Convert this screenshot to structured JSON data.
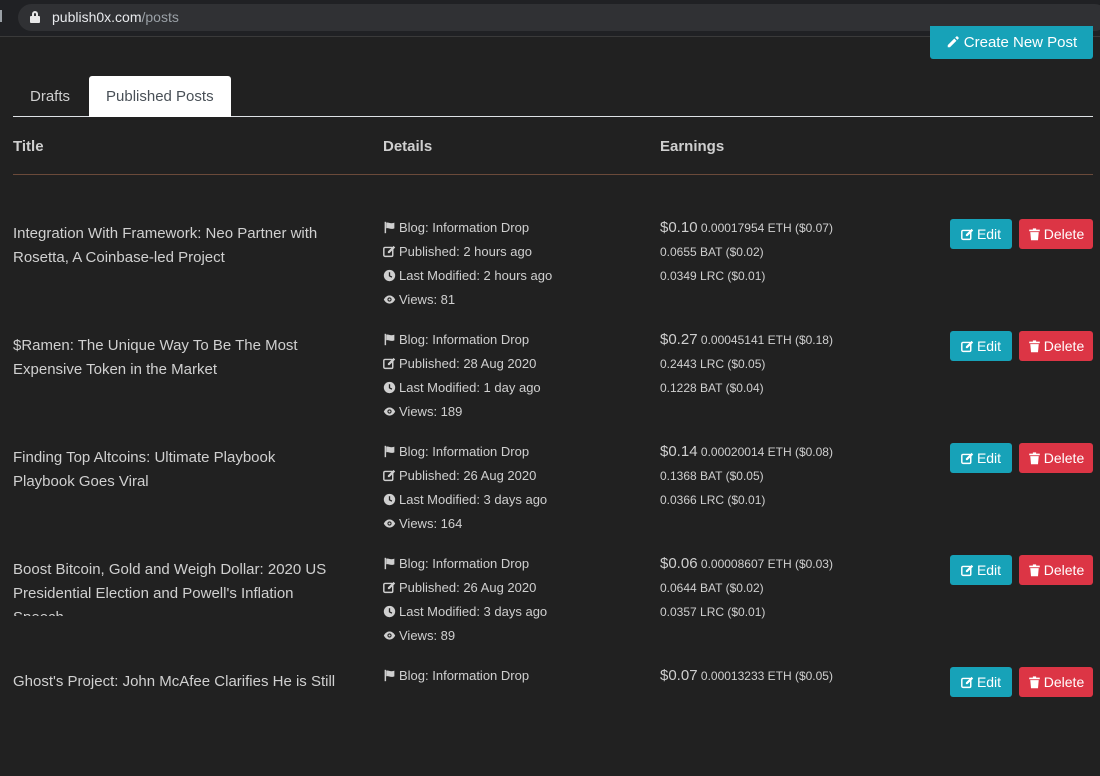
{
  "browser": {
    "url_domain": "publish0x.com",
    "url_path": "/posts"
  },
  "header": {
    "create_label": "Create New Post"
  },
  "tabs": [
    {
      "label": "Drafts"
    },
    {
      "label": "Published Posts"
    }
  ],
  "table": {
    "headers": {
      "title": "Title",
      "details": "Details",
      "earnings": "Earnings"
    },
    "rows": [
      {
        "title_lines": [
          "Integration With Framework: Neo Partner with",
          "Rosetta, A Coinbase-led Project"
        ],
        "blog": "Blog: Information Drop",
        "published": "Published: 2 hours ago",
        "modified": "Last Modified: 2 hours ago",
        "views": "Views: 81",
        "earn_total": "$0.10",
        "earn_main": "0.00017954 ETH ($0.07)",
        "earn_2": "0.0655 BAT ($0.02)",
        "earn_3": "0.0349 LRC ($0.01)",
        "edit": "Edit",
        "delete": "Delete"
      },
      {
        "title_lines": [
          "$Ramen: The Unique Way To Be The Most",
          "Expensive Token in the Market"
        ],
        "blog": "Blog: Information Drop",
        "published": "Published: 28 Aug 2020",
        "modified": "Last Modified: 1 day ago",
        "views": "Views: 189",
        "earn_total": "$0.27",
        "earn_main": "0.00045141 ETH ($0.18)",
        "earn_2": "0.2443 LRC ($0.05)",
        "earn_3": "0.1228 BAT ($0.04)",
        "edit": "Edit",
        "delete": "Delete"
      },
      {
        "title_lines": [
          "Finding Top Altcoins: Ultimate Playbook",
          "Playbook Goes Viral"
        ],
        "blog": "Blog: Information Drop",
        "published": "Published: 26 Aug 2020",
        "modified": "Last Modified: 3 days ago",
        "views": "Views: 164",
        "earn_total": "$0.14",
        "earn_main": "0.00020014 ETH ($0.08)",
        "earn_2": "0.1368 BAT ($0.05)",
        "earn_3": "0.0366 LRC ($0.01)",
        "edit": "Edit",
        "delete": "Delete"
      },
      {
        "title_lines": [
          "Boost Bitcoin, Gold and Weigh Dollar: 2020 US",
          "Presidential Election and Powell's Inflation",
          "Speech"
        ],
        "blog": "Blog: Information Drop",
        "published": "Published: 26 Aug 2020",
        "modified": "Last Modified: 3 days ago",
        "views": "Views: 89",
        "earn_total": "$0.06",
        "earn_main": "0.00008607 ETH ($0.03)",
        "earn_2": "0.0644 BAT ($0.02)",
        "earn_3": "0.0357 LRC ($0.01)",
        "edit": "Edit",
        "delete": "Delete"
      },
      {
        "title_lines": [
          "Ghost's Project: John McAfee Clarifies He is Still"
        ],
        "blog": "Blog: Information Drop",
        "published": "",
        "modified": "",
        "views": "",
        "earn_total": "$0.07",
        "earn_main": "0.00013233 ETH ($0.05)",
        "earn_2": "",
        "earn_3": "",
        "edit": "Edit",
        "delete": "Delete"
      }
    ]
  }
}
